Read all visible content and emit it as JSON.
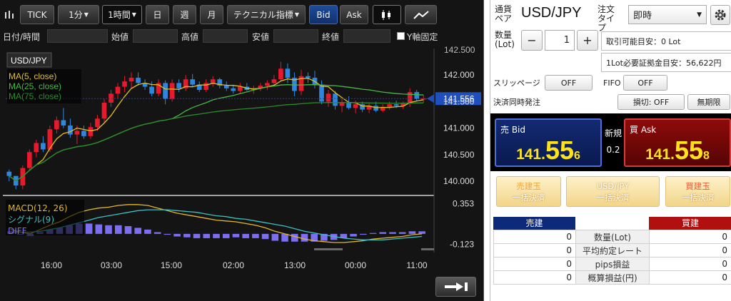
{
  "toolbar": {
    "tick_label": "TICK",
    "period_label": "1分",
    "timeframe_label": "1時間",
    "day_label": "日",
    "week_label": "週",
    "month_label": "月",
    "technical_label": "テクニカル指標",
    "bid_label": "Bid",
    "ask_label": "Ask",
    "chart_type_icons": [
      "candlestick-icon",
      "line-chart-icon"
    ]
  },
  "ohlc": {
    "date_label": "日付/時間",
    "open_label": "始値",
    "high_label": "高値",
    "low_label": "安値",
    "close_label": "終値",
    "yfix_label": "Y軸固定"
  },
  "chart": {
    "symbol": "USD/JPY",
    "legend": [
      "MA(5, close)",
      "MA(25, close)",
      "MA(75, close)"
    ],
    "current_price": "141.556",
    "top_partial_tick": "142.500",
    "macd_legend": [
      "MACD(12, 26)",
      "シグナル(9)",
      "DIFF"
    ],
    "macd_ticks": [
      "0.353",
      "-0.123"
    ],
    "colors": {
      "up": "#e8192c",
      "down": "#2f86e0",
      "ma5": "#e0c020",
      "ma25": "#45b845",
      "ma75": "#2c8a2c",
      "macd": "#e3b52a",
      "signal": "#3cc0c0",
      "diff": "#7b6ef0",
      "price_marker": "#1f4fbf"
    }
  },
  "chart_data": {
    "type": "candlestick",
    "title": "USD/JPY",
    "y_ticks": [
      142.0,
      141.5,
      141.0,
      140.5,
      140.0
    ],
    "x_ticks": [
      "16:00",
      "03:00",
      "15:00",
      "02:00",
      "13:00",
      "00:00",
      "11:00"
    ],
    "ylim": [
      139.8,
      142.5
    ],
    "candles": [
      [
        140.18,
        140.22,
        140.0,
        140.1
      ],
      [
        140.1,
        140.1,
        139.85,
        139.92
      ],
      [
        139.92,
        140.3,
        139.85,
        140.25
      ],
      [
        140.25,
        140.6,
        140.2,
        140.55
      ],
      [
        140.55,
        140.78,
        140.45,
        140.72
      ],
      [
        140.72,
        140.85,
        140.55,
        140.6
      ],
      [
        140.6,
        141.05,
        140.55,
        140.98
      ],
      [
        140.98,
        141.22,
        140.9,
        141.15
      ],
      [
        141.15,
        141.38,
        141.0,
        141.05
      ],
      [
        141.05,
        141.18,
        140.82,
        140.88
      ],
      [
        140.88,
        141.05,
        140.7,
        140.95
      ],
      [
        140.95,
        141.05,
        140.8,
        140.85
      ],
      [
        140.85,
        141.1,
        140.8,
        141.02
      ],
      [
        141.02,
        141.25,
        140.95,
        141.18
      ],
      [
        141.18,
        141.55,
        141.1,
        141.48
      ],
      [
        141.48,
        141.72,
        141.4,
        141.65
      ],
      [
        141.65,
        141.85,
        141.55,
        141.78
      ],
      [
        141.78,
        141.98,
        141.68,
        141.88
      ],
      [
        141.88,
        142.05,
        141.75,
        141.95
      ],
      [
        141.95,
        142.05,
        141.8,
        141.85
      ],
      [
        141.85,
        141.92,
        141.72,
        141.78
      ],
      [
        141.78,
        141.88,
        141.6,
        141.65
      ],
      [
        141.65,
        141.92,
        141.6,
        141.85
      ],
      [
        141.85,
        141.9,
        141.45,
        141.55
      ],
      [
        141.55,
        141.92,
        141.5,
        141.85
      ],
      [
        141.85,
        141.92,
        141.68,
        141.75
      ],
      [
        141.75,
        142.0,
        141.7,
        141.92
      ],
      [
        141.92,
        142.02,
        141.78,
        141.82
      ],
      [
        141.82,
        141.88,
        141.68,
        141.72
      ],
      [
        141.72,
        141.92,
        141.68,
        141.85
      ],
      [
        141.85,
        141.98,
        141.78,
        141.92
      ],
      [
        141.92,
        141.95,
        141.75,
        141.8
      ],
      [
        141.8,
        141.88,
        141.7,
        141.75
      ],
      [
        141.75,
        141.82,
        141.65,
        141.7
      ],
      [
        141.7,
        141.85,
        141.65,
        141.78
      ],
      [
        141.78,
        141.85,
        141.7,
        141.72
      ],
      [
        141.72,
        141.8,
        141.65,
        141.75
      ],
      [
        141.75,
        141.85,
        141.7,
        141.8
      ],
      [
        141.8,
        141.9,
        141.72,
        141.85
      ],
      [
        141.85,
        142.0,
        141.8,
        141.92
      ],
      [
        141.92,
        142.25,
        141.88,
        142.12
      ],
      [
        142.12,
        142.22,
        141.85,
        141.95
      ],
      [
        141.95,
        142.05,
        141.6,
        141.7
      ],
      [
        141.7,
        142.1,
        141.62,
        141.98
      ],
      [
        141.98,
        142.05,
        141.85,
        141.95
      ],
      [
        141.95,
        142.08,
        141.75,
        141.82
      ],
      [
        141.82,
        141.9,
        141.45,
        141.5
      ],
      [
        141.5,
        141.72,
        141.4,
        141.65
      ],
      [
        141.65,
        141.7,
        141.35,
        141.42
      ],
      [
        141.42,
        141.55,
        141.3,
        141.48
      ],
      [
        141.48,
        141.6,
        141.35,
        141.38
      ],
      [
        141.38,
        141.52,
        141.28,
        141.45
      ],
      [
        141.45,
        141.5,
        141.3,
        141.35
      ],
      [
        141.35,
        141.48,
        141.28,
        141.42
      ],
      [
        141.42,
        141.5,
        141.3,
        141.33
      ],
      [
        141.33,
        141.45,
        141.3,
        141.4
      ],
      [
        141.4,
        141.5,
        141.35,
        141.45
      ],
      [
        141.45,
        141.52,
        141.38,
        141.42
      ],
      [
        141.42,
        141.5,
        141.36,
        141.46
      ],
      [
        141.46,
        141.75,
        141.4,
        141.68
      ],
      [
        141.68,
        141.72,
        141.5,
        141.55
      ],
      [
        141.55,
        141.62,
        141.48,
        141.56
      ]
    ],
    "macd": [
      0.05,
      0.02,
      0.0,
      0.05,
      0.1,
      0.14,
      0.2,
      0.25,
      0.28,
      0.3,
      0.31,
      0.33,
      0.34,
      0.34,
      0.33,
      0.3,
      0.27,
      0.24,
      0.22,
      0.2,
      0.18,
      0.16,
      0.15,
      0.14,
      0.12,
      0.1,
      0.07,
      0.03,
      0.0,
      -0.03,
      -0.06,
      -0.08,
      -0.09,
      -0.1,
      -0.1,
      -0.09,
      -0.08,
      -0.06,
      -0.05,
      -0.04,
      -0.03,
      -0.01,
      0.0
    ],
    "signal": [
      0.02,
      0.02,
      0.02,
      0.03,
      0.05,
      0.07,
      0.1,
      0.13,
      0.16,
      0.19,
      0.21,
      0.23,
      0.25,
      0.27,
      0.28,
      0.28,
      0.28,
      0.27,
      0.26,
      0.25,
      0.23,
      0.21,
      0.2,
      0.18,
      0.17,
      0.15,
      0.13,
      0.11,
      0.09,
      0.06,
      0.03,
      0.01,
      -0.01,
      -0.03,
      -0.05,
      -0.06,
      -0.07,
      -0.07,
      -0.07,
      -0.06,
      -0.05,
      -0.04,
      -0.03
    ]
  },
  "order": {
    "pair_label": "通貨ペア",
    "pair": "USD/JPY",
    "order_type_label": "注文タイプ",
    "order_type": "即時",
    "qty_label": "数量(Lot)",
    "qty": "1",
    "minus": "−",
    "plus": "+",
    "available_lots": "取引可能目安：0 Lot",
    "margin_per_lot": "1Lot必要証拠金目安：56,622円",
    "slippage_label": "スリッページ",
    "slippage_value": "OFF",
    "fifo_label": "FIFO",
    "fifo_value": "OFF",
    "simultaneous_label": "決済同時発注",
    "stoploss_value": "損切: OFF",
    "expiry_value": "無期限",
    "bid_label": "売 Bid",
    "bid_small": "141.",
    "bid_big": "55",
    "bid_tail": "6",
    "spread_label": "新規",
    "spread_value": "0.2",
    "ask_label": "買 Ask",
    "ask_small": "141.",
    "ask_big": "55",
    "ask_tail": "8",
    "settle_sell": [
      "売建玉",
      "一括決済"
    ],
    "settle_pair": [
      "USD/JPY",
      "一括決済"
    ],
    "settle_buy": [
      "買建玉",
      "一括決済"
    ],
    "sell_header": "売建",
    "buy_header": "買建",
    "rows": [
      {
        "label": "数量(Lot)",
        "sell": "0",
        "buy": "0"
      },
      {
        "label": "平均約定レート",
        "sell": "0",
        "buy": "0"
      },
      {
        "label": "pips損益",
        "sell": "0",
        "buy": "0"
      },
      {
        "label": "概算損益(円)",
        "sell": "0",
        "buy": "0"
      }
    ]
  }
}
